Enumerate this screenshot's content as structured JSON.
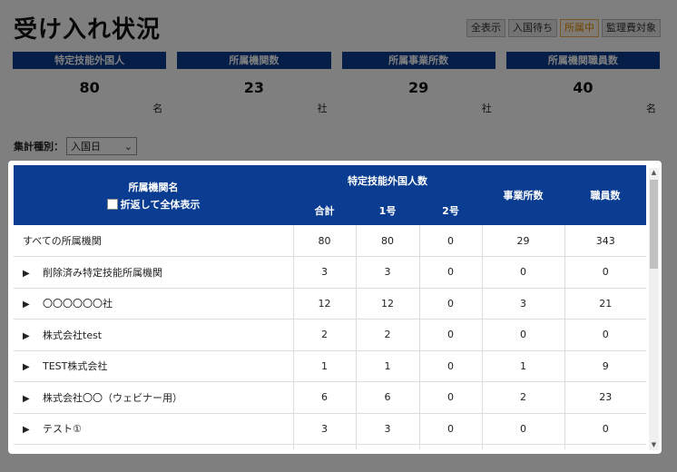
{
  "page": {
    "title": "受け入れ状況"
  },
  "filters": [
    {
      "label": "全表示",
      "active": false
    },
    {
      "label": "入国待ち",
      "active": false
    },
    {
      "label": "所属中",
      "active": true
    },
    {
      "label": "監理費対象",
      "active": false
    }
  ],
  "cards": [
    {
      "label": "特定技能外国人",
      "value": "80",
      "unit": "名"
    },
    {
      "label": "所属機関数",
      "value": "23",
      "unit": "社"
    },
    {
      "label": "所属事業所数",
      "value": "29",
      "unit": "社"
    },
    {
      "label": "所属機関職員数",
      "value": "40",
      "unit": "名"
    }
  ],
  "aggregate": {
    "label": "集計種別：",
    "selected": "入国日"
  },
  "table": {
    "headers": {
      "org_name": "所属機関名",
      "fold_label": "折返して全体表示",
      "foreign_workers": "特定技能外国人数",
      "total": "合計",
      "no1": "1号",
      "no2": "2号",
      "offices": "事業所数",
      "staff": "職員数"
    },
    "rows": [
      {
        "expand": "",
        "name": "すべての所属機関",
        "total": "80",
        "no1": "80",
        "no2": "0",
        "offices": "29",
        "staff": "343"
      },
      {
        "expand": "▶",
        "name": "削除済み特定技能所属機関",
        "total": "3",
        "no1": "3",
        "no2": "0",
        "offices": "0",
        "staff": "0"
      },
      {
        "expand": "▶",
        "name": "〇〇〇〇〇〇社",
        "total": "12",
        "no1": "12",
        "no2": "0",
        "offices": "3",
        "staff": "21"
      },
      {
        "expand": "▶",
        "name": "株式会社test",
        "total": "2",
        "no1": "2",
        "no2": "0",
        "offices": "0",
        "staff": "0"
      },
      {
        "expand": "▶",
        "name": "TEST株式会社",
        "total": "1",
        "no1": "1",
        "no2": "0",
        "offices": "1",
        "staff": "9"
      },
      {
        "expand": "▶",
        "name": "株式会社〇〇（ウェビナー用）",
        "total": "6",
        "no1": "6",
        "no2": "0",
        "offices": "2",
        "staff": "23"
      },
      {
        "expand": "▶",
        "name": "テスト①",
        "total": "3",
        "no1": "3",
        "no2": "0",
        "offices": "0",
        "staff": "0"
      }
    ]
  },
  "colors": {
    "header_blue": "#0a3d91",
    "active_filter": "#e08a00"
  }
}
